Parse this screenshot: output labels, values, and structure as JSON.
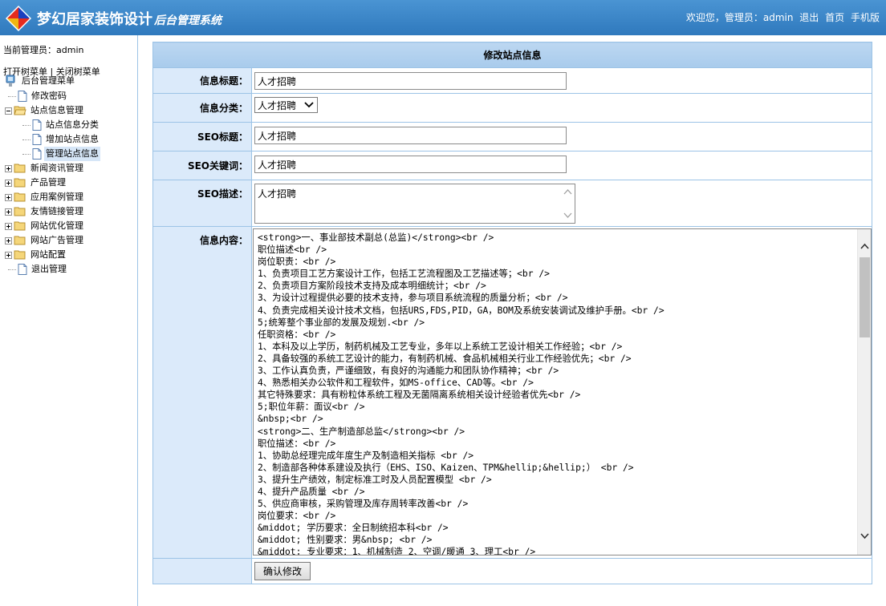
{
  "header": {
    "title": "梦幻居家装饰设计",
    "subtitle": "后台管理系统",
    "welcome": "欢迎您，管理员：admin",
    "logout": "退出",
    "home": "首页",
    "mobile": "手机版"
  },
  "sidebar": {
    "current_admin": "当前管理员：admin",
    "open_tree": "打开树菜单",
    "separator": "|",
    "close_tree": "关闭树菜单",
    "root": "后台管理菜单",
    "items": [
      {
        "label": "修改密码"
      },
      {
        "label": "站点信息管理"
      },
      {
        "label": "站点信息分类"
      },
      {
        "label": "增加站点信息"
      },
      {
        "label": "管理站点信息"
      },
      {
        "label": "新闻资讯管理"
      },
      {
        "label": "产品管理"
      },
      {
        "label": "应用案例管理"
      },
      {
        "label": "友情链接管理"
      },
      {
        "label": "网站优化管理"
      },
      {
        "label": "网站广告管理"
      },
      {
        "label": "网站配置"
      },
      {
        "label": "退出管理"
      }
    ]
  },
  "form": {
    "caption": "修改站点信息",
    "fields": {
      "title": {
        "label": "信息标题：",
        "value": "人才招聘"
      },
      "category": {
        "label": "信息分类：",
        "value": "人才招聘"
      },
      "seo_title": {
        "label": "SEO标题：",
        "value": "人才招聘"
      },
      "seo_keywords": {
        "label": "SEO关键词：",
        "value": "人才招聘"
      },
      "seo_desc": {
        "label": "SEO描述：",
        "value": "人才招聘"
      },
      "content": {
        "label": "信息内容：",
        "lines": [
          "<strong>一、事业部技术副总(总监)</strong><br />",
          "职位描述<br />",
          "岗位职责：<br />",
          "1、负责项目工艺方案设计工作，包括工艺流程图及工艺描述等；<br />",
          "2、负责项目方案阶段技术支持及成本明细统计；<br />",
          "3、为设计过程提供必要的技术支持，参与项目系统流程的质量分析；<br />",
          "4、负责完成相关设计技术文档，包括URS,FDS,PID，GA，BOM及系统安装调试及维护手册。<br />",
          "5;统筹整个事业部的发展及规划.<br />",
          "任职资格：<br />",
          "1、本科及以上学历，制药机械及工艺专业，多年以上系统工艺设计相关工作经验；<br />",
          "2、具备较强的系统工艺设计的能力，有制药机械、食品机械相关行业工作经验优先；<br />",
          "3、工作认真负责，严谨细致，有良好的沟通能力和团队协作精神；<br />",
          "4、熟悉相关办公软件和工程软件，如MS-office、CAD等。<br />",
          "其它特殊要求：具有粉粒体系统工程及无菌隔离系统相关设计经验者优先<br />",
          "5;职位年薪：面议<br />",
          "&nbsp;<br />",
          "<strong>二、生产制造部总监</strong><br />",
          "职位描述：<br />",
          "1、协助总经理完成年度生产及制造相关指标 <br />",
          "2、制造部各种体系建设及执行（EHS、ISO、Kaizen、TPM&hellip;&hellip;） <br />",
          "3、提升生产绩效，制定标准工时及人员配置模型 <br />",
          "4、提升产品质量 <br />",
          "5、供应商审核，采购管理及库存周转率改善<br />",
          "岗位要求：<br />",
          "&middot; 学历要求：全日制统招本科<br />",
          "&middot; 性别要求：男&nbsp; <br />",
          "&middot; 专业要求：1、机械制造 2、空调/暖通 3、理工<br />"
        ]
      }
    },
    "submit": "确认修改"
  }
}
